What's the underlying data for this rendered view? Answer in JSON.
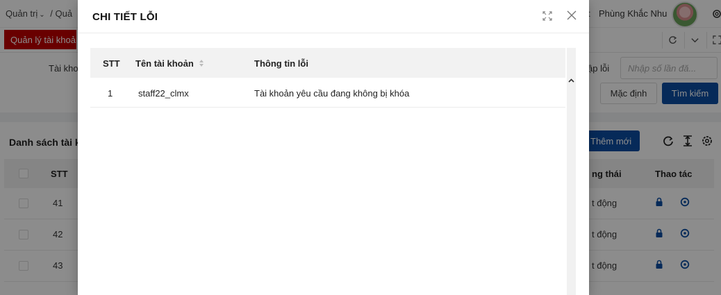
{
  "topbar": {
    "breadcrumb": [
      "Quản trị",
      "Quả"
    ],
    "user_name": "Phùng Khắc Nhu",
    "bell_fragment": "t"
  },
  "tabs": {
    "active_label": "Quản lý tài khoản"
  },
  "filter": {
    "left_label": "Tài khoả",
    "right_label": "ập lỗi",
    "input_placeholder": "Nhập số lần đă...",
    "reset_label": "Mặc định",
    "search_label": "Tìm kiếm"
  },
  "list": {
    "title": "Danh sách tài k",
    "add_label": "Thêm mới",
    "columns": {
      "stt": "STT",
      "status": "ng thái",
      "actions": "Thao tác"
    },
    "rows": [
      {
        "stt": "41",
        "status": "t động"
      },
      {
        "stt": "42",
        "status": "t động"
      },
      {
        "stt": "43",
        "status": "t động"
      }
    ]
  },
  "modal": {
    "title": "CHI TIẾT LỖI",
    "columns": {
      "stt": "STT",
      "account": "Tên tài khoản",
      "error": "Thông tin lỗi"
    },
    "rows": [
      {
        "stt": "1",
        "account": "staff22_clmx",
        "error": "Tài khoản yêu cầu đang không bị khóa"
      }
    ]
  },
  "colors": {
    "primary": "#0b4da2",
    "active_tab": "#c00000",
    "overlay": "rgba(0,0,0,0.45)"
  }
}
